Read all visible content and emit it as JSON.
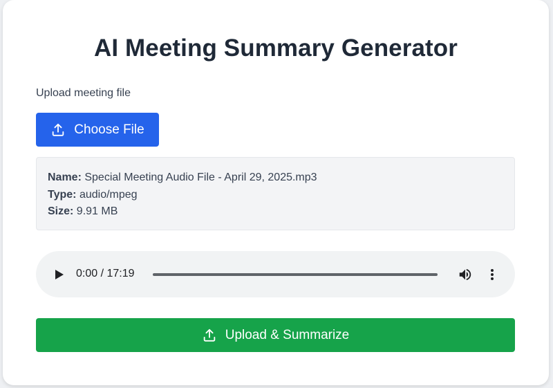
{
  "title": "AI Meeting Summary Generator",
  "upload": {
    "label": "Upload meeting file",
    "choose_button": "Choose File"
  },
  "file": {
    "name_label": "Name:",
    "name": "Special Meeting Audio File - April 29, 2025.mp3",
    "type_label": "Type:",
    "type": "audio/mpeg",
    "size_label": "Size:",
    "size": "9.91 MB"
  },
  "player": {
    "time": "0:00 / 17:19",
    "progress": 0
  },
  "submit_button": "Upload & Summarize",
  "colors": {
    "primary": "#2563eb",
    "success": "#16a34a",
    "title": "#1f2937"
  },
  "icons": {
    "choose": "upload-icon",
    "submit": "upload-icon",
    "play": "play-icon",
    "volume": "volume-icon",
    "more": "more-vertical-icon"
  }
}
